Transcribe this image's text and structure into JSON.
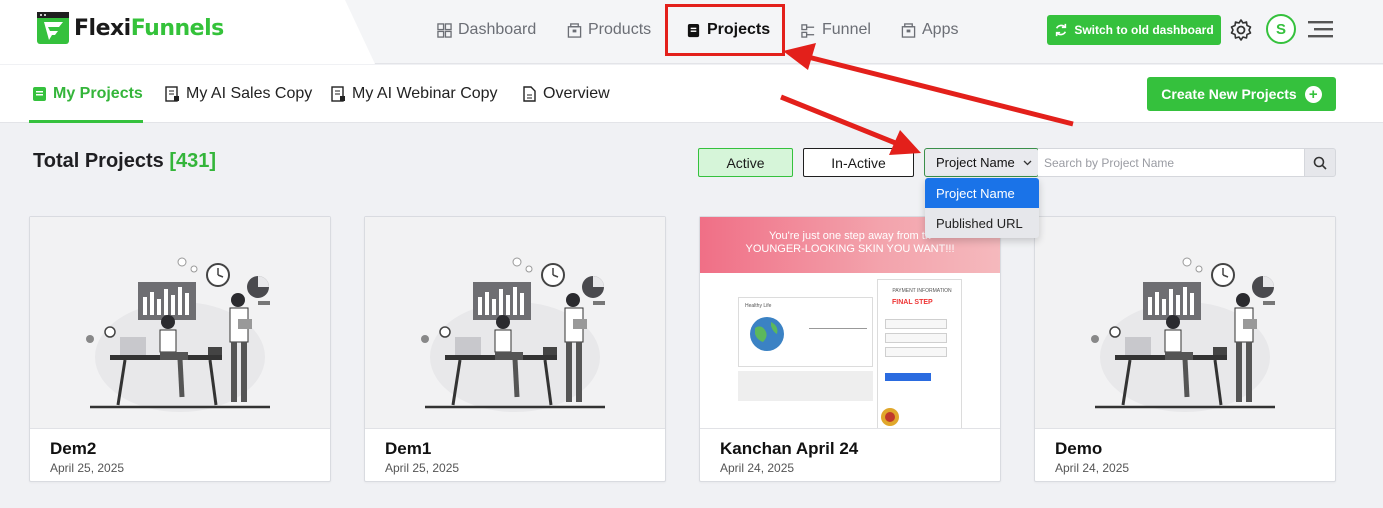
{
  "brand": {
    "name_part1": "Flexi",
    "name_part2": "Funnels",
    "accent_color": "#35c13d"
  },
  "nav": {
    "items": [
      {
        "label": "Dashboard",
        "icon": "grid-icon"
      },
      {
        "label": "Products",
        "icon": "box-icon"
      },
      {
        "label": "Projects",
        "icon": "document-icon",
        "active": true
      },
      {
        "label": "Funnel",
        "icon": "funnel-icon"
      },
      {
        "label": "Apps",
        "icon": "box-icon"
      }
    ]
  },
  "header": {
    "switch_label": "Switch to old dashboard",
    "avatar_initial": "S"
  },
  "subnav": {
    "items": [
      {
        "label": "My Projects",
        "active": true
      },
      {
        "label": "My AI Sales Copy"
      },
      {
        "label": "My AI Webinar Copy"
      },
      {
        "label": "Overview"
      }
    ],
    "create_label": "Create New Projects"
  },
  "filters": {
    "total_label": "Total Projects",
    "total_count": "[431]",
    "active_label": "Active",
    "inactive_label": "In-Active",
    "select_value": "Project Name",
    "search_placeholder": "Search by Project Name",
    "dropdown_options": [
      "Project Name",
      "Published URL"
    ]
  },
  "projects": [
    {
      "title": "Dem2",
      "date": "April 25, 2025"
    },
    {
      "title": "Dem1",
      "date": "April 25, 2025"
    },
    {
      "title": "Kanchan April 24",
      "date": "April 24, 2025",
      "thumb": {
        "line1": "You're just one step away from th",
        "line2": "YOUNGER-LOOKING SKIN YOU WANT!!!",
        "brand": "Healthy Life",
        "payment": "PAYMENT INFORMATION",
        "step": "FINAL STEP"
      }
    },
    {
      "title": "Demo",
      "date": "April 24, 2025"
    }
  ]
}
